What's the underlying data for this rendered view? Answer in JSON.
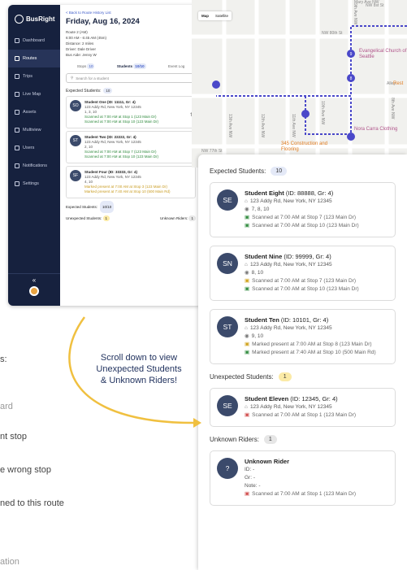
{
  "app": {
    "brand": "BusRight",
    "nav": [
      "Dashboard",
      "Routes",
      "Trips",
      "Live Map",
      "Assets",
      "Multiview",
      "Users",
      "Notifications",
      "Settings"
    ],
    "active_nav": "Routes",
    "collapse": "«"
  },
  "route_panel": {
    "back": "< Back to Route History List",
    "date": "Friday, Aug 16, 2024",
    "meta": [
      "Route 2 (AM)",
      "6:00 AM - 6:45 AM (45m)",
      "Distance: 2 miles",
      "Driver: Dale Driver",
      "Bus Aide: Jenny W"
    ],
    "tabs": [
      {
        "label": "Stops",
        "badge": "10"
      },
      {
        "label": "Students",
        "badge": "10/10"
      },
      {
        "label": "Event Log",
        "badge": ""
      }
    ],
    "search_placeholder": "Search for a student",
    "section_expected": "Expected Students:",
    "expected_count": "10",
    "students": [
      {
        "initials": "SO",
        "name": "Student One (ID: 11111, Gr: 4)",
        "address": "123 Addy Rd, New York, NY 12345",
        "stops": "1, 3, 10",
        "events": [
          {
            "type": "ok",
            "text": "Scanned at 7:00 AM at Stop 1 (123 Main Dr)"
          },
          {
            "type": "ok",
            "text": "Scanned at 7:00 AM at Stop 10 (123 Main Dr)"
          }
        ]
      },
      {
        "initials": "ST",
        "name": "Student Two (ID: 22222, Gr: 4)",
        "address": "123 Addy Rd, New York, NY 12345",
        "stops": "2, 10",
        "events": [
          {
            "type": "ok",
            "text": "Scanned at 7:00 AM at Stop 7 (123 Main Dr)"
          },
          {
            "type": "ok",
            "text": "Scanned at 7:00 AM at Stop 10 (123 Main Dr)"
          }
        ]
      },
      {
        "initials": "SF",
        "name": "Student Four (ID: 33333, Gr: 4)",
        "address": "123 Addy Rd, New York, NY 12345",
        "stops": "4, 10",
        "events": [
          {
            "type": "wr",
            "text": "Marked present at 7:00 AM at Stop 3 (123 Main Dr)"
          },
          {
            "type": "wr",
            "text": "Marked present at 7:40 AM at Stop 10 (500 Main Rd)"
          }
        ]
      }
    ],
    "expected_footer": "Expected Students:",
    "expected_footer_count": "10/10",
    "unexpected_label": "Unexpected Students:",
    "unexpected_count": "1",
    "unknown_label": "Unknown Riders:",
    "unknown_count": "1"
  },
  "map": {
    "toggle": [
      "Map",
      "Satellite"
    ],
    "streets": [
      "NW 8st St",
      "NW 80th St",
      "NW 77th St",
      "13th Ave NW",
      "12th Ave NW",
      "11th Ave NW",
      "10th Ave NW",
      "9th Ave NW",
      "8th Ave NW",
      "Mary Ave NW",
      "Alley"
    ],
    "pois": [
      "Evangelical Church of Seattle",
      "Nora Carra Clothing",
      "345 Construction and Flooring",
      "Rest"
    ]
  },
  "detail": {
    "expected_label": "Expected Students:",
    "expected_count": "10",
    "students": [
      {
        "initials": "SE",
        "name": "Student Eight",
        "meta": "(ID: 88888, Gr: 4)",
        "address": "123 Addy Rd, New York, NY 12345",
        "stops": "7, 8, 10",
        "events": [
          {
            "type": "ok",
            "text": "Scanned at 7:00 AM at Stop 7 (123 Main Dr)"
          },
          {
            "type": "ok",
            "text": "Scanned at 7:00 AM at Stop 10 (123 Main Dr)"
          }
        ]
      },
      {
        "initials": "SN",
        "name": "Student Nine",
        "meta": "(ID: 99999, Gr: 4)",
        "address": "123 Addy Rd, New York, NY 12345",
        "stops": "8, 10",
        "events": [
          {
            "type": "wr",
            "text": "Scanned at 7:00 AM at Stop 7 (123 Main Dr)"
          },
          {
            "type": "ok",
            "text": "Scanned at 7:00 AM at Stop 10 (123 Main Dr)"
          }
        ]
      },
      {
        "initials": "ST",
        "name": "Student Ten",
        "meta": "(ID: 10101, Gr: 4)",
        "address": "123 Addy Rd, New York, NY 12345",
        "stops": "9, 10",
        "events": [
          {
            "type": "wr",
            "text": "Marked present at 7:00 AM at Stop 8 (123 Main Dr)"
          },
          {
            "type": "ok",
            "text": "Marked present at 7:40 AM at Stop 10 (500 Main Rd)"
          }
        ]
      }
    ],
    "unexpected_label": "Unexpected Students:",
    "unexpected_count": "1",
    "unexpected": {
      "initials": "SE",
      "name": "Student Eleven",
      "meta": "(ID: 12345, Gr: 4)",
      "address": "123 Addy Rd, New York, NY 12345",
      "event": "Scanned at 7:00 AM at Stop 1 (123 Main Dr)"
    },
    "unknown_label": "Unknown Riders:",
    "unknown_count": "1",
    "unknown": {
      "initials": "?",
      "name": "Unknown Rider",
      "id": "ID: -",
      "gr": "Gr: -",
      "note": "Note: -",
      "event": "Scanned at 7:00 AM at Stop 1 (123 Main Dr)"
    }
  },
  "callout": [
    "Scroll down to view",
    "Unexpected Students",
    "& Unknown Riders!"
  ],
  "left_fragments": [
    "s:",
    "ard",
    "nt stop",
    "e wrong stop",
    "ned to this route",
    "ation"
  ],
  "colors": {
    "sidebar": "#16213e",
    "accent": "#3d5ac9",
    "route": "#4a48c9",
    "arrow": "#f0c040"
  }
}
